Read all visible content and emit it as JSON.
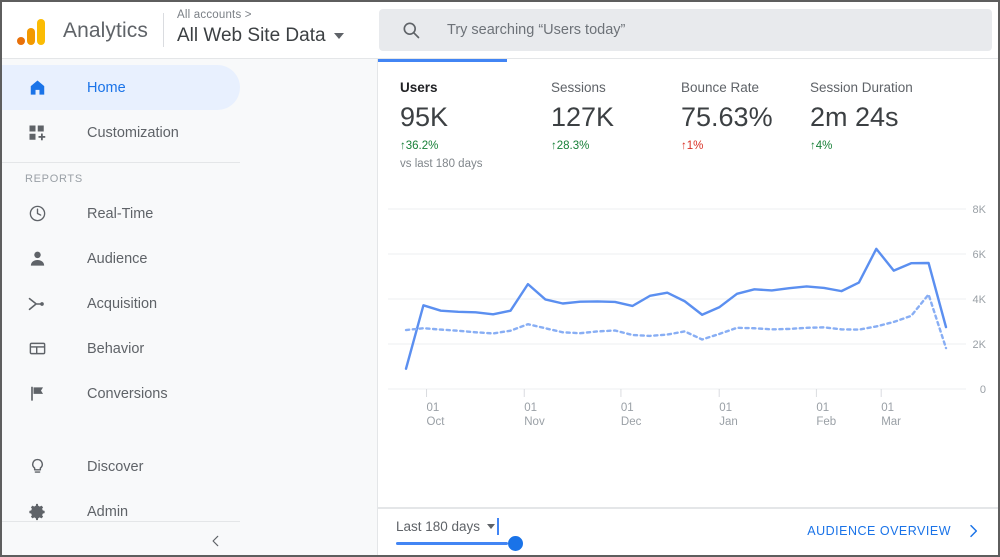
{
  "header": {
    "brand_name": "Analytics",
    "logo_icon": "google-analytics-logo",
    "account_breadcrumb": "All accounts >",
    "account_name": "All Web Site Data",
    "account_caret_icon": "chevron-down-icon",
    "search_icon": "search-icon",
    "search_placeholder": "Try searching “Users today”",
    "search_value": ""
  },
  "sidebar": {
    "items": [
      {
        "label": "Home",
        "icon": "home-icon",
        "active": true
      },
      {
        "label": "Customization",
        "icon": "customization-icon",
        "active": false
      }
    ],
    "section_label": "REPORTS",
    "reports": [
      {
        "label": "Real-Time",
        "icon": "clock-icon"
      },
      {
        "label": "Audience",
        "icon": "person-icon"
      },
      {
        "label": "Acquisition",
        "icon": "acquisition-icon"
      },
      {
        "label": "Behavior",
        "icon": "behavior-icon"
      },
      {
        "label": "Conversions",
        "icon": "flag-icon"
      }
    ],
    "bottom": [
      {
        "label": "Discover",
        "icon": "lightbulb-icon"
      },
      {
        "label": "Admin",
        "icon": "gear-icon"
      }
    ],
    "collapse_icon": "chevron-left-icon"
  },
  "main": {
    "metrics": [
      {
        "label": "Users",
        "value": "95K",
        "delta": "36.2%",
        "direction": "up",
        "compare": "vs last 180 days"
      },
      {
        "label": "Sessions",
        "value": "127K",
        "delta": "28.3%",
        "direction": "up",
        "compare": ""
      },
      {
        "label": "Bounce Rate",
        "value": "75.63%",
        "delta": "1%",
        "direction": "down",
        "compare": ""
      },
      {
        "label": "Session Duration",
        "value": "2m 24s",
        "delta": "4%",
        "direction": "up",
        "compare": ""
      }
    ],
    "arrow_up": "↑",
    "arrow_down": "↑"
  },
  "footer": {
    "date_range": "Last 180 days",
    "date_caret_icon": "chevron-down-icon",
    "audience_link": "AUDIENCE OVERVIEW",
    "audience_chevron_icon": "chevron-right-icon"
  },
  "colors": {
    "accent_blue": "#4285f4",
    "link_blue": "#1a73e8",
    "active_pill": "#e8f0fe",
    "up_green": "#188038",
    "down_red": "#d93025",
    "logo_orange": "#f29900",
    "logo_yellow": "#fbbc04",
    "logo_dark_orange": "#e8710a"
  },
  "chart_data": {
    "type": "line",
    "title": "",
    "xlabel": "",
    "ylabel": "",
    "ylim": [
      0,
      8000
    ],
    "yticks": [
      0,
      2000,
      4000,
      6000,
      8000
    ],
    "ytick_labels": [
      "0",
      "2K",
      "4K",
      "6K",
      "8K"
    ],
    "grid": true,
    "legend": "none",
    "xtick_labels": [
      {
        "day": "01",
        "month": "Oct"
      },
      {
        "day": "01",
        "month": "Nov"
      },
      {
        "day": "01",
        "month": "Dec"
      },
      {
        "day": "01",
        "month": "Jan"
      },
      {
        "day": "01",
        "month": "Feb"
      },
      {
        "day": "01",
        "month": "Mar"
      }
    ],
    "xtick_positions": [
      0.038,
      0.219,
      0.398,
      0.58,
      0.76,
      0.88
    ],
    "series": [
      {
        "name": "Users",
        "style": "solid",
        "color": "#5b8ff0",
        "values": [
          900,
          3720,
          3480,
          3430,
          3410,
          3320,
          3480,
          4660,
          3980,
          3800,
          3880,
          3890,
          3870,
          3690,
          4140,
          4280,
          3900,
          3300,
          3640,
          4230,
          4430,
          4380,
          4480,
          4560,
          4490,
          4350,
          4730,
          6230,
          5260,
          5590,
          5600,
          2750
        ]
      },
      {
        "name": "Users (previous period)",
        "style": "dotted",
        "color": "#88aef4",
        "values": [
          2620,
          2700,
          2640,
          2590,
          2520,
          2470,
          2590,
          2880,
          2700,
          2520,
          2480,
          2560,
          2600,
          2400,
          2360,
          2420,
          2560,
          2200,
          2450,
          2720,
          2700,
          2650,
          2670,
          2720,
          2740,
          2650,
          2640,
          2780,
          2980,
          3250,
          4200,
          1820
        ]
      }
    ]
  }
}
